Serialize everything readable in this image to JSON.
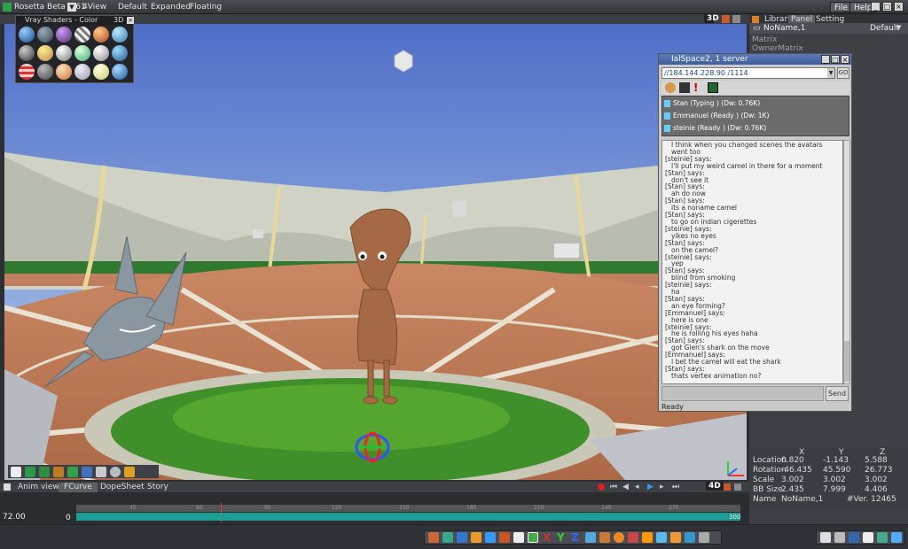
{
  "app": {
    "title": "Rosetta Beta 7.61",
    "menus": [
      "4View",
      "Default",
      "Expanded",
      "Floating"
    ],
    "right_menus": [
      "File",
      "Help"
    ]
  },
  "viewport": {
    "mode": "3D"
  },
  "shaders": {
    "title": "Vray Shaders - Color",
    "mode": "3D"
  },
  "right_panel": {
    "tabs": [
      "Library",
      "Panel",
      "Setting"
    ],
    "object": "NoName,1",
    "preset": "Default",
    "properties": [
      "Matrix",
      "OwnerMatrix"
    ]
  },
  "chat": {
    "title": "IalSpace2, 1 server",
    "server": "//184.144.228.90 /1114",
    "go": "GO",
    "users": [
      "Stan (Typing ) (Dw: 0.76K)",
      "Emmanuel (Ready ) (Dw: 1K)",
      "steinie (Ready ) (Dw: 0.76K)"
    ],
    "log": [
      {
        "t": "msg",
        "s": "I think when you changed scenes the avatars went too"
      },
      {
        "t": "sp",
        "s": "[steinie] says:"
      },
      {
        "t": "msg",
        "s": "I'll put my weird camel in there for a moment"
      },
      {
        "t": "sp",
        "s": "[Stan] says:"
      },
      {
        "t": "msg",
        "s": "don't see it"
      },
      {
        "t": "sp",
        "s": "[Stan] says:"
      },
      {
        "t": "msg",
        "s": "ah do now"
      },
      {
        "t": "sp",
        "s": "[Stan] says:"
      },
      {
        "t": "msg",
        "s": "its a noname camel"
      },
      {
        "t": "sp",
        "s": "[Stan] says:"
      },
      {
        "t": "msg",
        "s": "to go on indian cigerettes"
      },
      {
        "t": "sp",
        "s": "[steinie] says:"
      },
      {
        "t": "msg",
        "s": "yikes no eyes"
      },
      {
        "t": "sp",
        "s": "[Stan] says:"
      },
      {
        "t": "msg",
        "s": "on the camel?"
      },
      {
        "t": "sp",
        "s": "[steinie] says:"
      },
      {
        "t": "msg",
        "s": "yep"
      },
      {
        "t": "sp",
        "s": "[Stan] says:"
      },
      {
        "t": "msg",
        "s": "blind from smoking"
      },
      {
        "t": "sp",
        "s": "[steinie] says:"
      },
      {
        "t": "msg",
        "s": "ha"
      },
      {
        "t": "sp",
        "s": "[Stan] says:"
      },
      {
        "t": "msg",
        "s": "an eye forming?"
      },
      {
        "t": "sp",
        "s": "[Emmanuel] says:"
      },
      {
        "t": "msg",
        "s": "here is one"
      },
      {
        "t": "sp",
        "s": "[steinie] says:"
      },
      {
        "t": "msg",
        "s": "he is rolling his eyes haha"
      },
      {
        "t": "sp",
        "s": "[Stan] says:"
      },
      {
        "t": "msg",
        "s": "got Glen's shark on the move"
      },
      {
        "t": "sp",
        "s": "[Emmanuel] says:"
      },
      {
        "t": "msg",
        "s": "I bet the camel will eat the shark"
      },
      {
        "t": "sp",
        "s": "[Stan] says:"
      },
      {
        "t": "msg",
        "s": "thats vertex animation no?"
      }
    ],
    "send": "Send",
    "status": "Ready"
  },
  "transform": {
    "headers": [
      "X",
      "Y",
      "Z"
    ],
    "rows": [
      {
        "label": "Location",
        "x": "0.820",
        "y": "-1.143",
        "z": "5.588"
      },
      {
        "label": "Rotation",
        "x": "-46.435",
        "y": "45.590",
        "z": "26.773"
      },
      {
        "label": "Scale",
        "x": "3.002",
        "y": "3.002",
        "z": "3.002"
      },
      {
        "label": "BB Size",
        "x": "2.435",
        "y": "7.999",
        "z": "4.406"
      }
    ],
    "name_label": "Name",
    "name": "NoName,1",
    "ver": "#Ver. 12465"
  },
  "anim": {
    "tabs": [
      "Anim view",
      "FCurve",
      "DopeSheet",
      "Story"
    ],
    "mode": "4D",
    "time": "72.00",
    "start": "0",
    "end": "300",
    "ticks": [
      "45",
      "60",
      "90",
      "120",
      "150",
      "185",
      "210",
      "240",
      "270"
    ]
  }
}
